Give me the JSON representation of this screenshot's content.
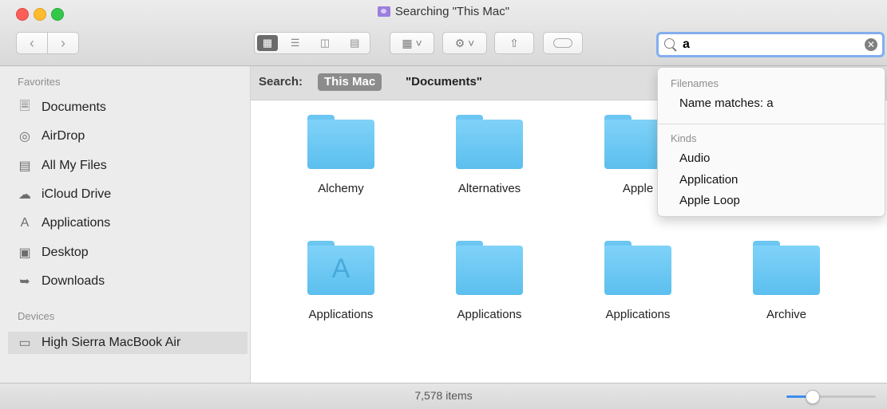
{
  "window": {
    "title": "Searching \"This Mac\""
  },
  "toolbar": {
    "back_icon": "chevron-left",
    "forward_icon": "chevron-right",
    "view_modes": [
      "icon",
      "list",
      "column",
      "cover-flow"
    ],
    "active_view": "icon",
    "arrange_icon": "grid",
    "action_icon": "gear",
    "share_icon": "share",
    "tag_icon": "tag",
    "search_value": "a"
  },
  "sidebar": {
    "favorites_title": "Favorites",
    "favorites": [
      {
        "label": "Documents",
        "icon": "documents-icon"
      },
      {
        "label": "AirDrop",
        "icon": "airdrop-icon"
      },
      {
        "label": "All My Files",
        "icon": "all-files-icon"
      },
      {
        "label": "iCloud Drive",
        "icon": "cloud-icon"
      },
      {
        "label": "Applications",
        "icon": "applications-icon"
      },
      {
        "label": "Desktop",
        "icon": "desktop-icon"
      },
      {
        "label": "Downloads",
        "icon": "downloads-icon"
      }
    ],
    "devices_title": "Devices",
    "devices": [
      {
        "label": "High Sierra MacBook Air",
        "icon": "laptop-icon"
      }
    ]
  },
  "scope": {
    "label": "Search:",
    "active": "This Mac",
    "alternate": "\"Documents\""
  },
  "items": [
    {
      "label": "Alchemy",
      "type": "folder"
    },
    {
      "label": "Alternatives",
      "type": "folder"
    },
    {
      "label": "Apple",
      "type": "folder"
    },
    {
      "label": "",
      "type": "hidden"
    },
    {
      "label": "Applications",
      "type": "app-folder"
    },
    {
      "label": "Applications",
      "type": "folder"
    },
    {
      "label": "Applications",
      "type": "folder"
    },
    {
      "label": "Archive",
      "type": "folder"
    }
  ],
  "dropdown": {
    "filenames_title": "Filenames",
    "name_match": "Name matches: a",
    "kinds_title": "Kinds",
    "kinds": [
      "Audio",
      "Application",
      "Apple Loop"
    ]
  },
  "status": {
    "item_count": "7,578 items",
    "zoom_level": 0.25
  },
  "colors": {
    "accent": "#3d8cf0",
    "folder": "#6cc6f2",
    "search_focus": "#83aef0"
  }
}
